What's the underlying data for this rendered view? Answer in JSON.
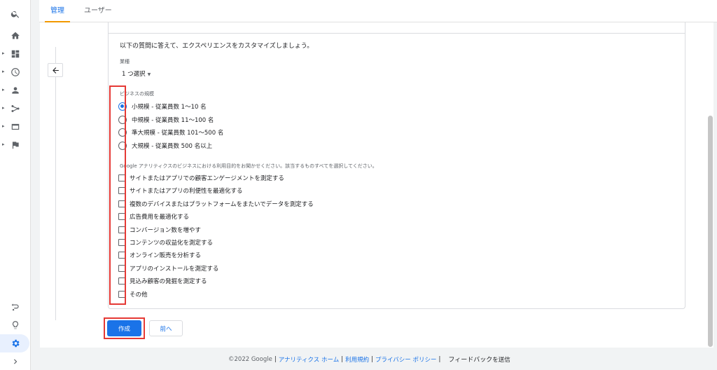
{
  "tabs": [
    "管理",
    "ユーザー"
  ],
  "intro": "以下の質問に答えて、エクスペリエンスをカスタマイズしましょう。",
  "industry": {
    "label": "業種",
    "value": "1 つ選択"
  },
  "business_size": {
    "label": "ビジネスの規模",
    "selected_index": 0,
    "options": [
      "小規模 - 従業員数 1〜10 名",
      "中規模 - 従業員数 11〜100 名",
      "準大規模 - 従業員数 101〜500 名",
      "大規模 - 従業員数 500 名以上"
    ]
  },
  "usage": {
    "label": "Google アナリティクスのビジネスにおける利用目的をお聞かせください。該当するものすべてを選択してください。",
    "options": [
      "サイトまたはアプリでの顧客エンゲージメントを測定する",
      "サイトまたはアプリの利便性を最適化する",
      "複数のデバイスまたはプラットフォームをまたいでデータを測定する",
      "広告費用を最適化する",
      "コンバージョン数を増やす",
      "コンテンツの収益化を測定する",
      "オンライン販売を分析する",
      "アプリのインストールを測定する",
      "見込み顧客の発掘を測定する",
      "その他"
    ]
  },
  "buttons": {
    "create": "作成",
    "prev": "前へ"
  },
  "footer": {
    "copyright": "©2022 Google",
    "links": [
      "アナリティクス ホーム",
      "利用規約",
      "プライバシー ポリシー"
    ],
    "feedback": "フィードバック",
    "feedback_tail": "を送信"
  },
  "colors": {
    "accent": "#1a73e8",
    "highlight": "#e53935",
    "tab_underline": "#f29900"
  }
}
